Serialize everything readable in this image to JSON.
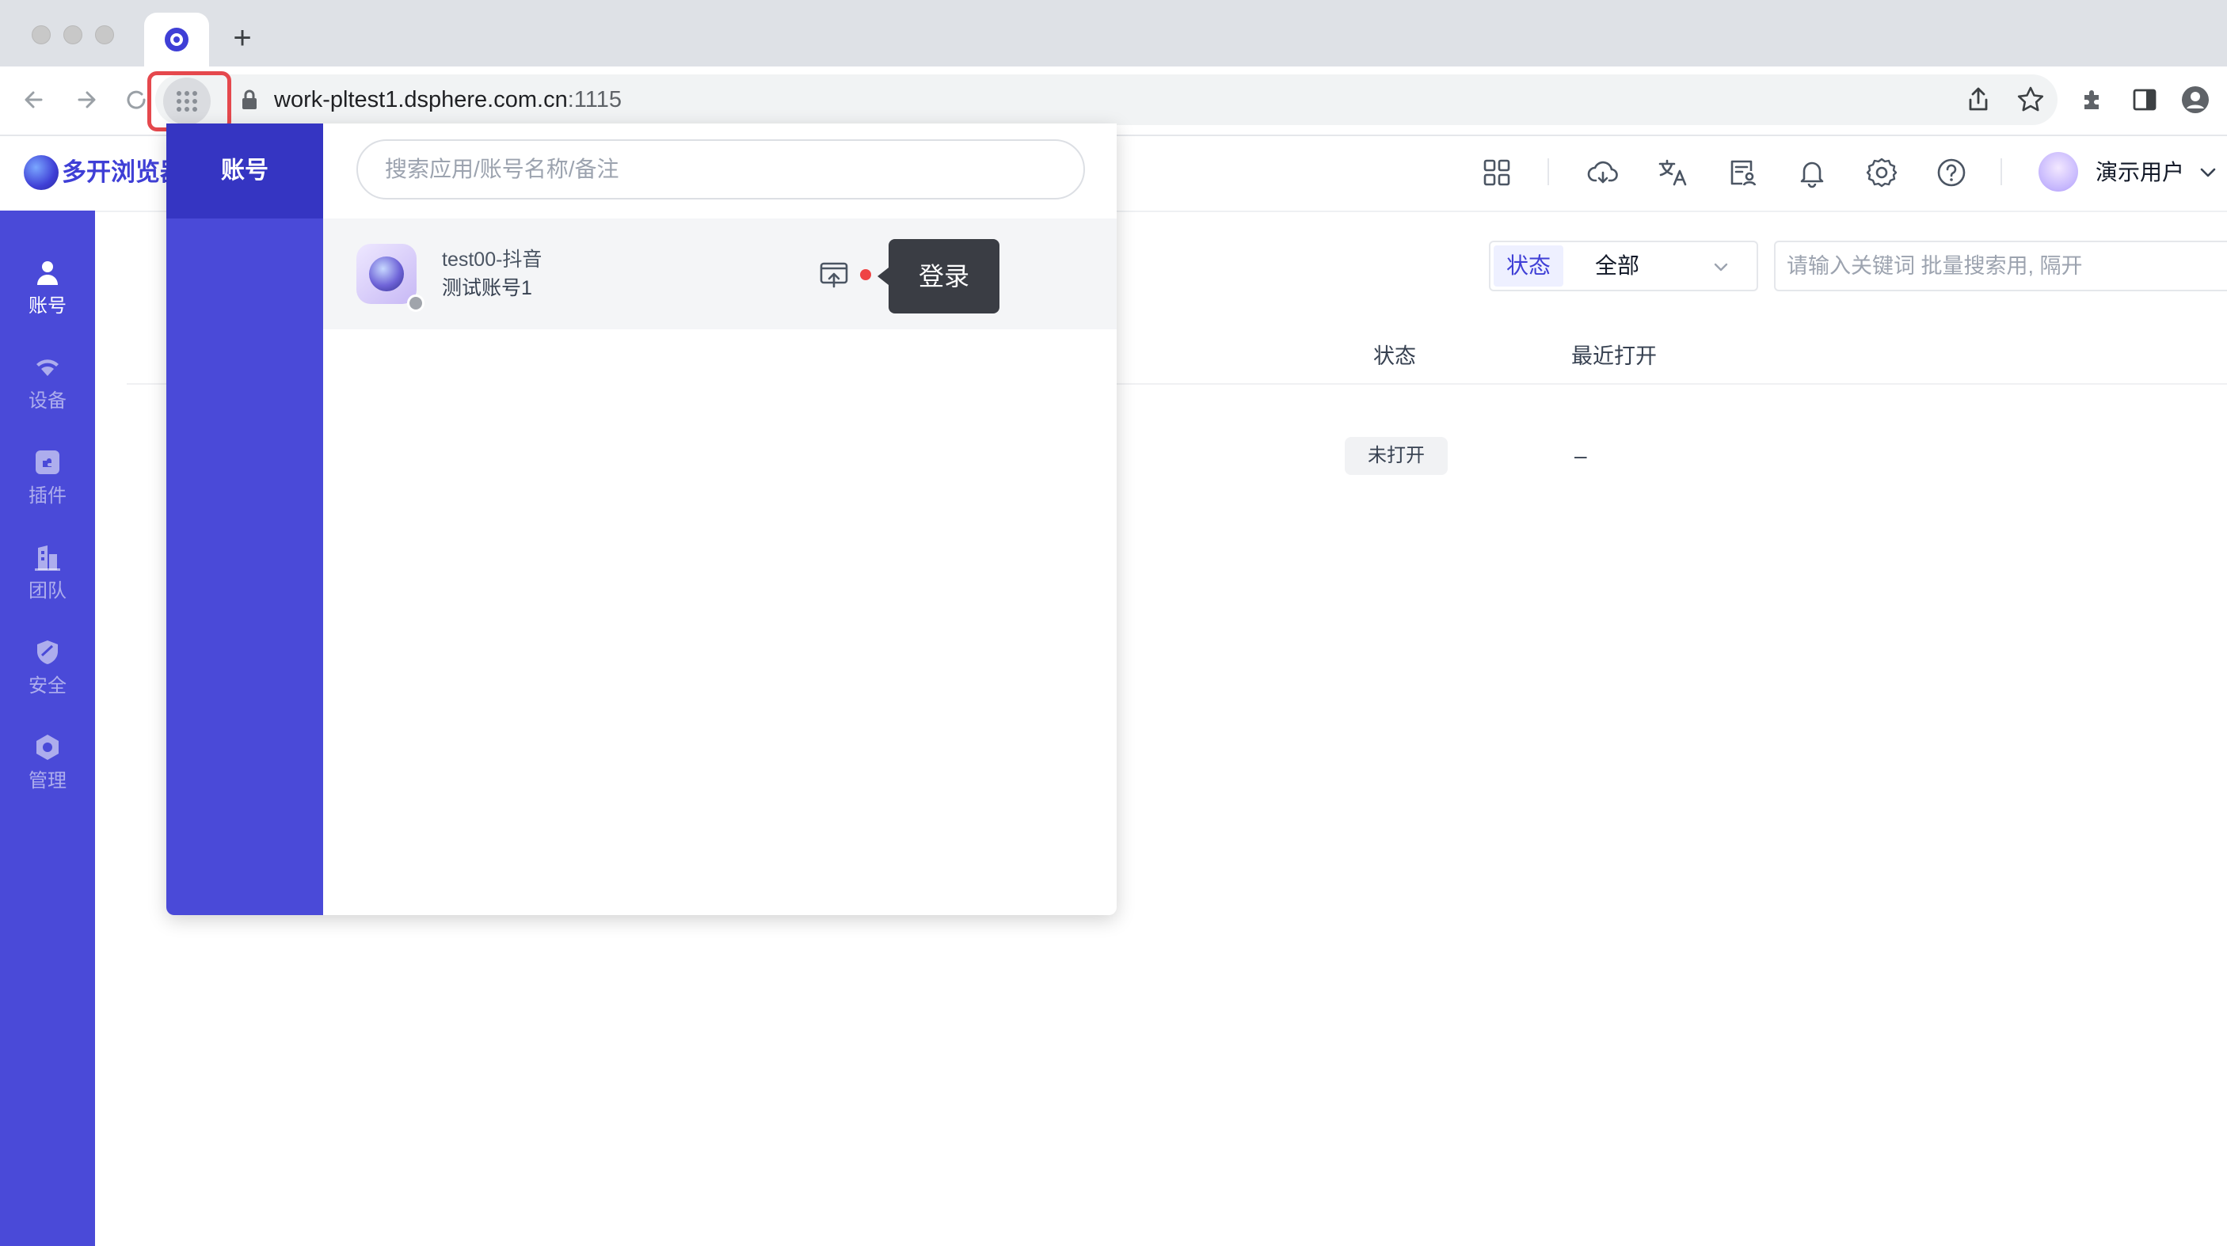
{
  "browser": {
    "new_tab_label": "+",
    "address": {
      "host": "work-pltest1.dsphere.com.cn",
      "port": ":1115"
    }
  },
  "app_header": {
    "brand_name": "多开浏览器",
    "user_name": "演示用户",
    "icons": [
      "apps-grid-icon",
      "cloud-sync-icon",
      "translate-icon",
      "contacts-icon",
      "bell-icon",
      "gear-icon",
      "help-icon"
    ]
  },
  "sidebar": {
    "items": [
      {
        "label": "账号",
        "icon": "user-icon",
        "active": true
      },
      {
        "label": "设备",
        "icon": "wifi-icon",
        "active": false
      },
      {
        "label": "插件",
        "icon": "puzzle-icon",
        "active": false
      },
      {
        "label": "团队",
        "icon": "building-icon",
        "active": false
      },
      {
        "label": "安全",
        "icon": "shield-icon",
        "active": false
      },
      {
        "label": "管理",
        "icon": "settings-icon",
        "active": false
      }
    ]
  },
  "main": {
    "filter": {
      "label": "状态",
      "value": "全部"
    },
    "search_placeholder": "请输入关键词 批量搜索用, 隔开",
    "columns": {
      "status": "状态",
      "last_opened": "最近打开"
    },
    "rows": [
      {
        "status": "未打开",
        "last_opened": "–"
      }
    ]
  },
  "popup": {
    "tab_label": "账号",
    "search_placeholder": "搜索应用/账号名称/备注",
    "accounts": [
      {
        "name": "test00-抖音",
        "remark": "测试账号1"
      }
    ],
    "tooltip": "登录"
  },
  "colors": {
    "brand": "#4a4ad8",
    "brand_dark": "#3535c2",
    "highlight": "#e5484d",
    "tooltip_bg": "#3a3d44"
  }
}
